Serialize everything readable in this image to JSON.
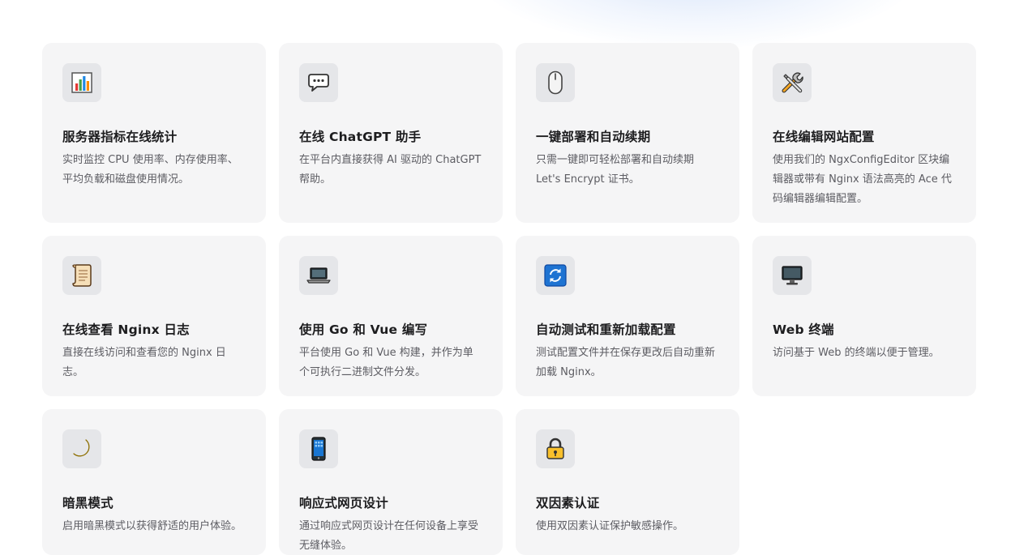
{
  "features": [
    {
      "icon": "bar-chart-icon",
      "title": "服务器指标在线统计",
      "desc": "实时监控 CPU 使用率、内存使用率、平均负载和磁盘使用情况。"
    },
    {
      "icon": "chat-bubble-icon",
      "title": "在线 ChatGPT 助手",
      "desc": "在平台内直接获得 AI 驱动的 ChatGPT 帮助。"
    },
    {
      "icon": "mouse-icon",
      "title": "一键部署和自动续期",
      "desc": "只需一键即可轻松部署和自动续期 Let's Encrypt 证书。"
    },
    {
      "icon": "tools-icon",
      "title": "在线编辑网站配置",
      "desc": "使用我们的 NgxConfigEditor 区块编辑器或带有 Nginx 语法高亮的 Ace 代码编辑器编辑配置。"
    },
    {
      "icon": "scroll-icon",
      "title": "在线查看 Nginx 日志",
      "desc": "直接在线访问和查看您的 Nginx 日志。"
    },
    {
      "icon": "laptop-icon",
      "title": "使用 Go 和 Vue 编写",
      "desc": "平台使用 Go 和 Vue 构建，并作为单个可执行二进制文件分发。"
    },
    {
      "icon": "refresh-icon",
      "title": "自动测试和重新加载配置",
      "desc": "测试配置文件并在保存更改后自动重新加载 Nginx。"
    },
    {
      "icon": "desktop-monitor-icon",
      "title": "Web 终端",
      "desc": "访问基于 Web 的终端以便于管理。"
    },
    {
      "icon": "crescent-moon-icon",
      "title": "暗黑模式",
      "desc": "启用暗黑模式以获得舒适的用户体验。"
    },
    {
      "icon": "mobile-phone-icon",
      "title": "响应式网页设计",
      "desc": "通过响应式网页设计在任何设备上享受无缝体验。"
    },
    {
      "icon": "lock-icon",
      "title": "双因素认证",
      "desc": "使用双因素认证保护敏感操作。"
    }
  ]
}
